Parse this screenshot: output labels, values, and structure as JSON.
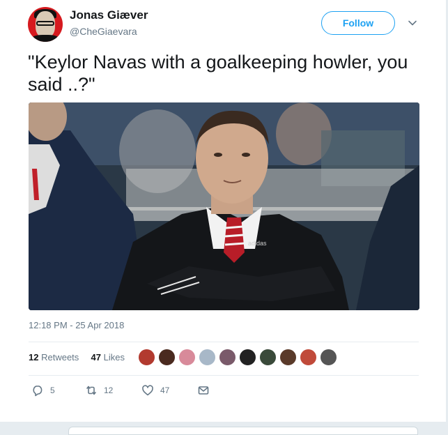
{
  "user": {
    "name": "Jonas Giæver",
    "handle": "@CheGiaevara"
  },
  "follow_label": "Follow",
  "tweet": {
    "text": "\"Keylor Navas with a goalkeeping howler, you said ..?\"",
    "timestamp": "12:18 PM - 25 Apr 2018"
  },
  "stats": {
    "retweets_count": "12",
    "retweets_label": "Retweets",
    "likes_count": "47",
    "likes_label": "Likes"
  },
  "actions": {
    "reply_count": "5",
    "retweet_count": "12",
    "like_count": "47"
  },
  "colors": {
    "accent": "#1da1f2",
    "avatar_red": "#d61a1f"
  },
  "icons": [
    "chevron-down-icon",
    "reply-icon",
    "retweet-icon",
    "heart-icon",
    "message-icon"
  ]
}
